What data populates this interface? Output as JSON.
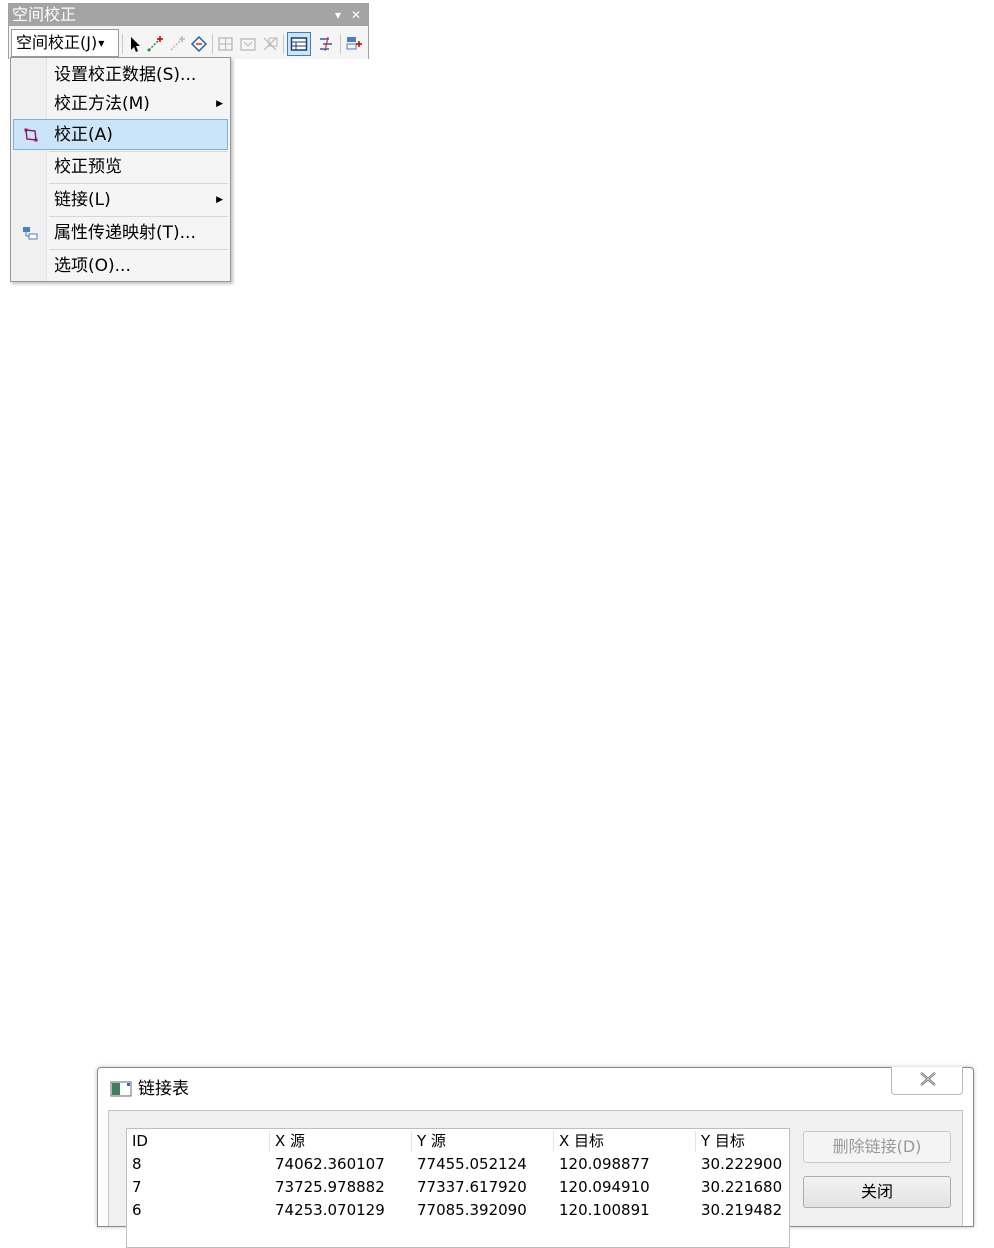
{
  "toolbar": {
    "title": "空间校正",
    "menu_button_label": "空间校正(J)",
    "title_buttons": [
      "▾",
      "✕"
    ],
    "tools": [
      "select-elements-icon",
      "new-displacement-link-icon",
      "modify-link-icon",
      "multiple-displacement-links-icon",
      "new-identity-link-icon",
      "new-limited-adjustment-area-icon",
      "clear-limited-adjustment-area-icon",
      "view-link-table-icon",
      "edge-match-icon",
      "attribute-transfer-icon"
    ]
  },
  "menu": {
    "items": [
      {
        "label": "设置校正数据(S)...",
        "submenu": false
      },
      {
        "label": "校正方法(M)",
        "submenu": true
      },
      {
        "label": "校正(A)",
        "submenu": false,
        "highlighted": true,
        "icon": "adjust-icon"
      },
      {
        "label": "校正预览",
        "submenu": false
      },
      {
        "label": "链接(L)",
        "submenu": true
      },
      {
        "label": "属性传递映射(T)...",
        "submenu": false,
        "icon": "attribute-transfer-mapping-icon"
      },
      {
        "label": "选项(O)...",
        "submenu": false
      }
    ]
  },
  "dialog": {
    "title": "链接表",
    "close_glyph": "✕",
    "columns": [
      "ID",
      "X 源",
      "Y 源",
      "X 目标",
      "Y 目标"
    ],
    "rows": [
      [
        "8",
        "74062.360107",
        "77455.052124",
        "120.098877",
        "30.222900"
      ],
      [
        "7",
        "73725.978882",
        "77337.617920",
        "120.094910",
        "30.221680"
      ],
      [
        "6",
        "74253.070129",
        "77085.392090",
        "120.100891",
        "30.219482"
      ]
    ],
    "delete_button": "删除链接(D)",
    "close_button": "关闭"
  },
  "colors": {
    "menu_highlight": "#cce4f7",
    "title_bar": "#a4a4a4"
  }
}
